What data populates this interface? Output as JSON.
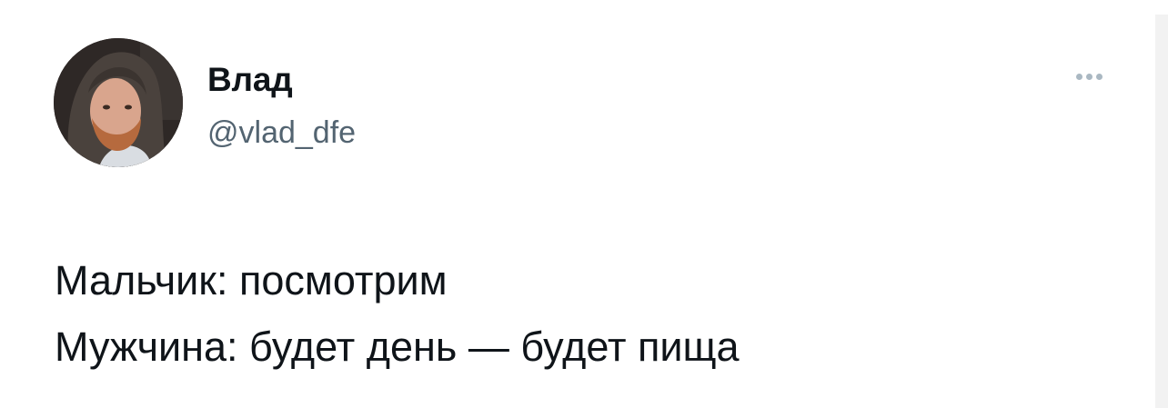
{
  "author": {
    "display_name": "Влад",
    "handle": "@vlad_dfe"
  },
  "tweet": {
    "lines": [
      "Мальчик: посмотрим",
      "Мужчина: будет день — будет пища"
    ]
  },
  "icons": {
    "more": "more-horizontal-icon",
    "avatar": "avatar-photo"
  },
  "colors": {
    "text": "#0f1419",
    "handle": "#536471",
    "more_dots": "#aab8c2",
    "background": "#ffffff"
  }
}
